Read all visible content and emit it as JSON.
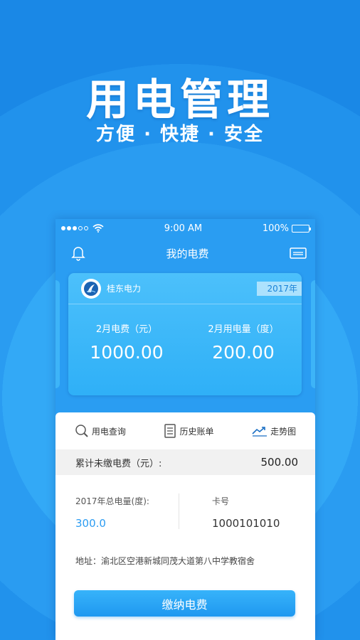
{
  "hero": {
    "title": "用电管理",
    "subtitle": "方便 · 快捷 · 安全"
  },
  "status_bar": {
    "time": "9:00 AM",
    "battery": "100%",
    "battery_level": 1.0
  },
  "nav": {
    "title": "我的电费",
    "left_icon": "bell-icon",
    "right_icon": "card-icon"
  },
  "card": {
    "company": "桂东电力",
    "year": "2017年",
    "fee_label": "2月电费（元）",
    "fee_value": "1000.00",
    "usage_label": "2月用电量（度）",
    "usage_value": "200.00"
  },
  "tabs": [
    {
      "label": "用电查询",
      "icon": "search-icon"
    },
    {
      "label": "历史账单",
      "icon": "bill-icon"
    },
    {
      "label": "走势图",
      "icon": "trend-icon"
    }
  ],
  "summary": {
    "label": "累计未缴电费（元）:",
    "value": "500.00"
  },
  "info": {
    "total_label": "2017年总电量(度):",
    "total_value": "300.0",
    "card_label": "卡号",
    "card_value": "1000101010"
  },
  "address": "地址：渝北区空港新城同茂大道第八中学教宿舍",
  "pay_button": "缴纳电费",
  "colors": {
    "accent": "#2c9cf2",
    "background": "#1e8fea",
    "card": "#3db4f8"
  }
}
